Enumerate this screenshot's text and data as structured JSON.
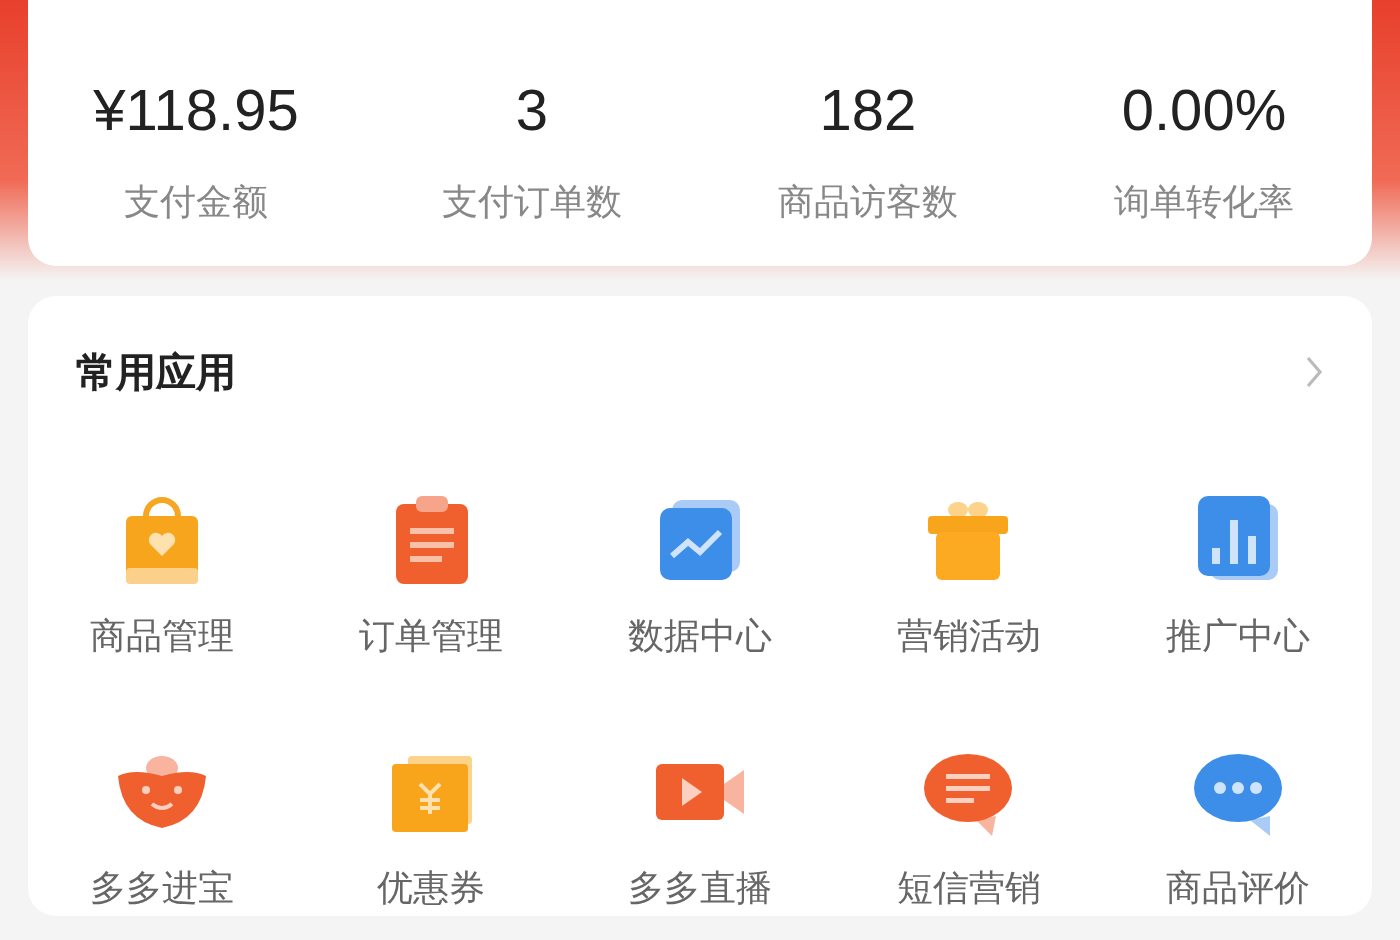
{
  "stats": [
    {
      "value": "¥118.95",
      "label": "支付金额"
    },
    {
      "value": "3",
      "label": "支付订单数"
    },
    {
      "value": "182",
      "label": "商品访客数"
    },
    {
      "value": "0.00%",
      "label": "询单转化率"
    }
  ],
  "apps": {
    "title": "常用应用",
    "items": [
      {
        "label": "商品管理"
      },
      {
        "label": "订单管理"
      },
      {
        "label": "数据中心"
      },
      {
        "label": "营销活动"
      },
      {
        "label": "推广中心"
      },
      {
        "label": "多多进宝"
      },
      {
        "label": "优惠券"
      },
      {
        "label": "多多直播"
      },
      {
        "label": "短信营销"
      },
      {
        "label": "商品评价"
      }
    ]
  }
}
